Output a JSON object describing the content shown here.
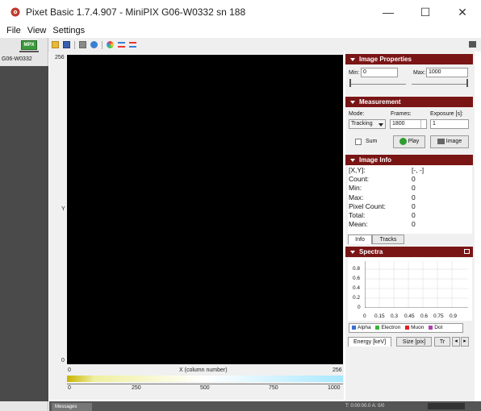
{
  "window": {
    "title": "Pixet Basic 1.7.4.907 - MiniPIX G06-W0332 sn 188",
    "minimize_glyph": "—",
    "maximize_glyph": "☐",
    "close_glyph": "✕"
  },
  "menu": {
    "items": [
      "File",
      "View",
      "Settings"
    ]
  },
  "toolbar": {
    "icons": [
      "folder-icon",
      "save-icon",
      "grid-icon",
      "refresh-icon",
      "color-icon",
      "sigma-icon",
      "sum-icon"
    ]
  },
  "device": {
    "icon_text": "MPX",
    "label": "G06-W0332"
  },
  "plot": {
    "y_max_label": "256",
    "y_min_label": "0",
    "y_axis_label": "Y",
    "x_min_label": "0",
    "x_max_label": "256",
    "x_axis_label": "X (column number)",
    "colorbar_ticks": [
      "0",
      "250",
      "500",
      "750",
      "1000"
    ]
  },
  "image_properties": {
    "header": "Image Properties",
    "min_label": "Min:",
    "min_value": "0",
    "max_label": "Max:",
    "max_value": "1000"
  },
  "measurement": {
    "header": "Measurement",
    "mode_label": "Mode:",
    "mode_value": "Tracking",
    "frames_label": "Frames:",
    "frames_value": "1800",
    "exposure_label": "Exposure [s]:",
    "exposure_value": "1",
    "sum_label": "Sum",
    "play_label": "Play",
    "image_label": "Image"
  },
  "image_info": {
    "header": "Image Info",
    "rows": [
      {
        "label": "[X,Y]:",
        "value": "[-, -]"
      },
      {
        "label": "Count:",
        "value": "0"
      },
      {
        "label": "Min:",
        "value": "0"
      },
      {
        "label": "Max:",
        "value": "0"
      },
      {
        "label": "Pixel Count:",
        "value": "0"
      },
      {
        "label": "Total:",
        "value": "0"
      },
      {
        "label": "Mean:",
        "value": "0"
      }
    ],
    "tabs": [
      "Info",
      "Tracks"
    ]
  },
  "spectra": {
    "header": "Spectra",
    "y_ticks": [
      "0.8",
      "0.6",
      "0.4",
      "0.2",
      "0"
    ],
    "x_ticks": [
      "0",
      "0.15",
      "0.3",
      "0.45",
      "0.6",
      "0.75",
      "0.9"
    ],
    "legend": [
      {
        "name": "Alpha",
        "color": "#3b6fd6"
      },
      {
        "name": "Electron",
        "color": "#3bb33b"
      },
      {
        "name": "Muon",
        "color": "#e02020"
      },
      {
        "name": "Dot",
        "color": "#b040b0"
      }
    ],
    "tabs": [
      "Energy [keV]",
      "Size [pix]",
      "Tr"
    ]
  },
  "status": {
    "messages_tab": "Messages",
    "status_text": "T: 0:00:00.0   A: 0/0"
  }
}
